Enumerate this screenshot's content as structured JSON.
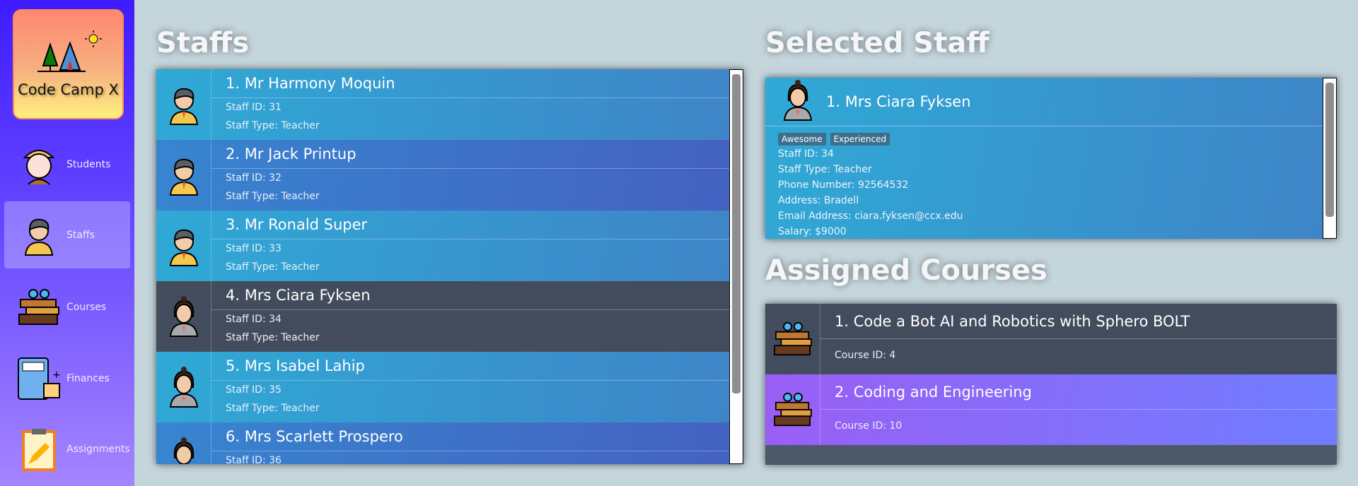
{
  "sidebar": {
    "logo_text": "Code Camp X",
    "items": [
      {
        "label": "Students",
        "icon": "student-icon",
        "selected": false
      },
      {
        "label": "Staffs",
        "icon": "staff-icon",
        "selected": true
      },
      {
        "label": "Courses",
        "icon": "books-icon",
        "selected": false
      },
      {
        "label": "Finances",
        "icon": "calculator-icon",
        "selected": false
      },
      {
        "label": "Assignments",
        "icon": "clipboard-icon",
        "selected": false
      }
    ]
  },
  "staffs": {
    "title": "Staffs",
    "items": [
      {
        "name": "1. Mr Harmony Moquin",
        "id": "Staff ID: 31",
        "type": "Staff Type: Teacher",
        "gender": "male"
      },
      {
        "name": "2. Mr Jack Printup",
        "id": "Staff ID: 32",
        "type": "Staff Type: Teacher",
        "gender": "male"
      },
      {
        "name": "3. Mr Ronald Super",
        "id": "Staff ID: 33",
        "type": "Staff Type: Teacher",
        "gender": "male"
      },
      {
        "name": "4. Mrs Ciara Fyksen",
        "id": "Staff ID: 34",
        "type": "Staff Type: Teacher",
        "gender": "female",
        "selected": true
      },
      {
        "name": "5. Mrs Isabel Lahip",
        "id": "Staff ID: 35",
        "type": "Staff Type: Teacher",
        "gender": "female"
      },
      {
        "name": "6. Mrs Scarlett Prospero",
        "id": "Staff ID: 36",
        "type": "",
        "gender": "female"
      }
    ]
  },
  "selected": {
    "title": "Selected Staff",
    "name": "1.  Mrs Ciara Fyksen",
    "tags": [
      "Awesome",
      "Experienced"
    ],
    "lines": [
      "Staff ID: 34",
      "Staff Type: Teacher",
      "Phone Number: 92564532",
      "Address: Bradell",
      "Email Address: ciara.fyksen@ccx.edu",
      "Salary: $9000"
    ]
  },
  "courses": {
    "title": "Assigned Courses",
    "items": [
      {
        "name": "1. Code a Bot AI and Robotics with Sphero BOLT",
        "id": "Course ID: 4"
      },
      {
        "name": "2. Coding and Engineering",
        "id": "Course ID: 10"
      }
    ]
  }
}
